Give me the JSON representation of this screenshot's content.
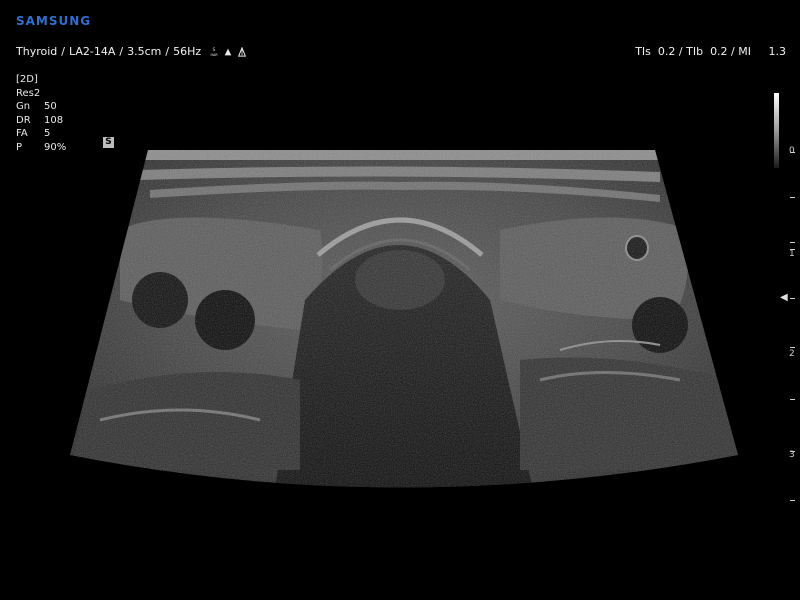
{
  "brand": "SAMSUNG",
  "header": {
    "preset": "Thyroid",
    "probe": "LA2-14A",
    "depth": "3.5cm",
    "frame_rate": "56Hz",
    "icons": [
      "s-har-icon",
      "flow-icon",
      "focus-icon"
    ]
  },
  "indices": {
    "tis_label": "TIs",
    "tis_value": "0.2",
    "tib_label": "TIb",
    "tib_value": "0.2",
    "mi_label": "MI",
    "mi_value": "1.3"
  },
  "params": {
    "mode": "[2D]",
    "resolution": "Res2",
    "rows": [
      {
        "key": "Gn",
        "value": "50"
      },
      {
        "key": "DR",
        "value": "108"
      },
      {
        "key": "FA",
        "value": "5"
      },
      {
        "key": "P",
        "value": "90%"
      }
    ]
  },
  "s_badge": "S",
  "depth_scale": {
    "labels": [
      "0",
      "1",
      "2",
      "3"
    ],
    "focus_depth_cm": 1.6
  },
  "colors": {
    "brand": "#2f6fd0",
    "background": "#000000",
    "text": "#f2f2f2"
  }
}
